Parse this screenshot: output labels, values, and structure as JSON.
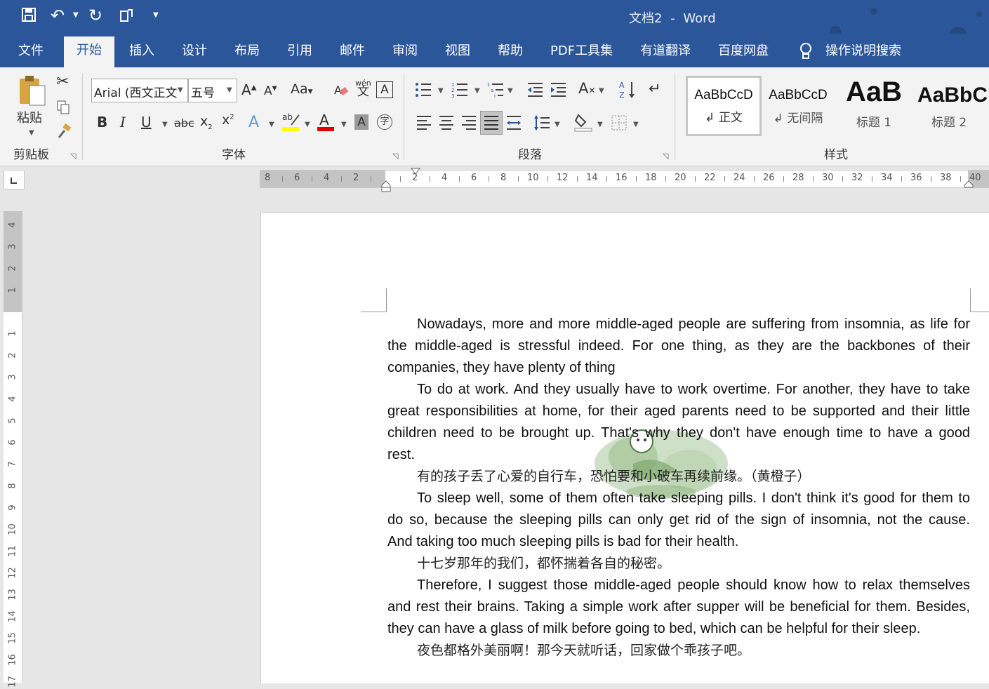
{
  "title": {
    "doc_name": "文档2",
    "sep": "-",
    "app": "Word"
  },
  "tabs": [
    {
      "label": "文件"
    },
    {
      "label": "开始"
    },
    {
      "label": "插入"
    },
    {
      "label": "设计"
    },
    {
      "label": "布局"
    },
    {
      "label": "引用"
    },
    {
      "label": "邮件"
    },
    {
      "label": "审阅"
    },
    {
      "label": "视图"
    },
    {
      "label": "帮助"
    },
    {
      "label": "PDF工具集"
    },
    {
      "label": "有道翻译"
    },
    {
      "label": "百度网盘"
    },
    {
      "label": "操作说明搜索"
    }
  ],
  "ribbon": {
    "clipboard": {
      "paste": "粘贴",
      "group": "剪贴板"
    },
    "font": {
      "family": "Arial (西文正文",
      "size": "五号",
      "group": "字体",
      "case_label": "Aa",
      "phonetic_top": "wén",
      "phonetic_bottom": "文",
      "strike": "abc"
    },
    "paragraph": {
      "group": "段落"
    },
    "styles": {
      "group": "样式",
      "items": [
        {
          "preview": "AaBbCcD",
          "name": "↲ 正文"
        },
        {
          "preview": "AaBbCcD",
          "name": "↲ 无间隔"
        },
        {
          "preview": "AaB",
          "name": "标题 1"
        },
        {
          "preview": "AaBbC",
          "name": "标题 2"
        }
      ]
    }
  },
  "ruler": {
    "h_left": [
      "8",
      "6",
      "4",
      "2"
    ],
    "h_right": [
      "2",
      "4",
      "6",
      "8",
      "10",
      "12",
      "14",
      "16",
      "18",
      "20",
      "22",
      "24",
      "26",
      "28",
      "30",
      "32",
      "34",
      "36",
      "38",
      "40"
    ],
    "v_top": [
      "4",
      "3",
      "2",
      "1"
    ],
    "v_body": [
      "1",
      "2",
      "3",
      "4",
      "5",
      "6",
      "7",
      "8",
      "9",
      "10",
      "11",
      "12",
      "13",
      "14",
      "15",
      "16",
      "17"
    ]
  },
  "document": {
    "paragraphs": [
      {
        "lines": [
          "Nowadays, more and more middle-aged people are suffering from insomnia, as life for",
          "the middle-aged is stressful indeed. For one thing, as they are the backbones of their",
          "companies, they have plenty of thing"
        ]
      },
      {
        "lines": [
          "To do at work. And they usually have to work overtime. For another, they have to take",
          "great responsibilities at home, for their aged parents need to be supported and their little",
          "children need to be brought up. That's why they don't have enough time to have a good",
          "rest."
        ]
      },
      {
        "lines": [
          "有的孩子丢了心爱的自行车，恐怕要和小破车再续前缘。（黄橙子）"
        ]
      },
      {
        "lines": [
          "To sleep well, some of them often take sleeping pills. I don't think it's good for them to",
          "do so, because the sleeping pills can only get rid of the sign of insomnia, not the cause.",
          "And taking too much sleeping pills is bad for their health."
        ]
      },
      {
        "lines": [
          "十七岁那年的我们，都怀揣着各自的秘密。"
        ]
      },
      {
        "lines": [
          "Therefore, I suggest those middle-aged people should know how to relax themselves",
          "and rest their brains. Taking a simple work after supper will be beneficial for them. Besides,",
          "they can have a glass of milk before going to bed, which can be helpful for their sleep."
        ]
      },
      {
        "lines": [
          "夜色都格外美丽啊！那今天就听话，回家做个乖孩子吧。"
        ]
      }
    ]
  },
  "colors": {
    "brand": "#2b579a",
    "highlight": "#ffff00",
    "font_color": "#e00000"
  }
}
